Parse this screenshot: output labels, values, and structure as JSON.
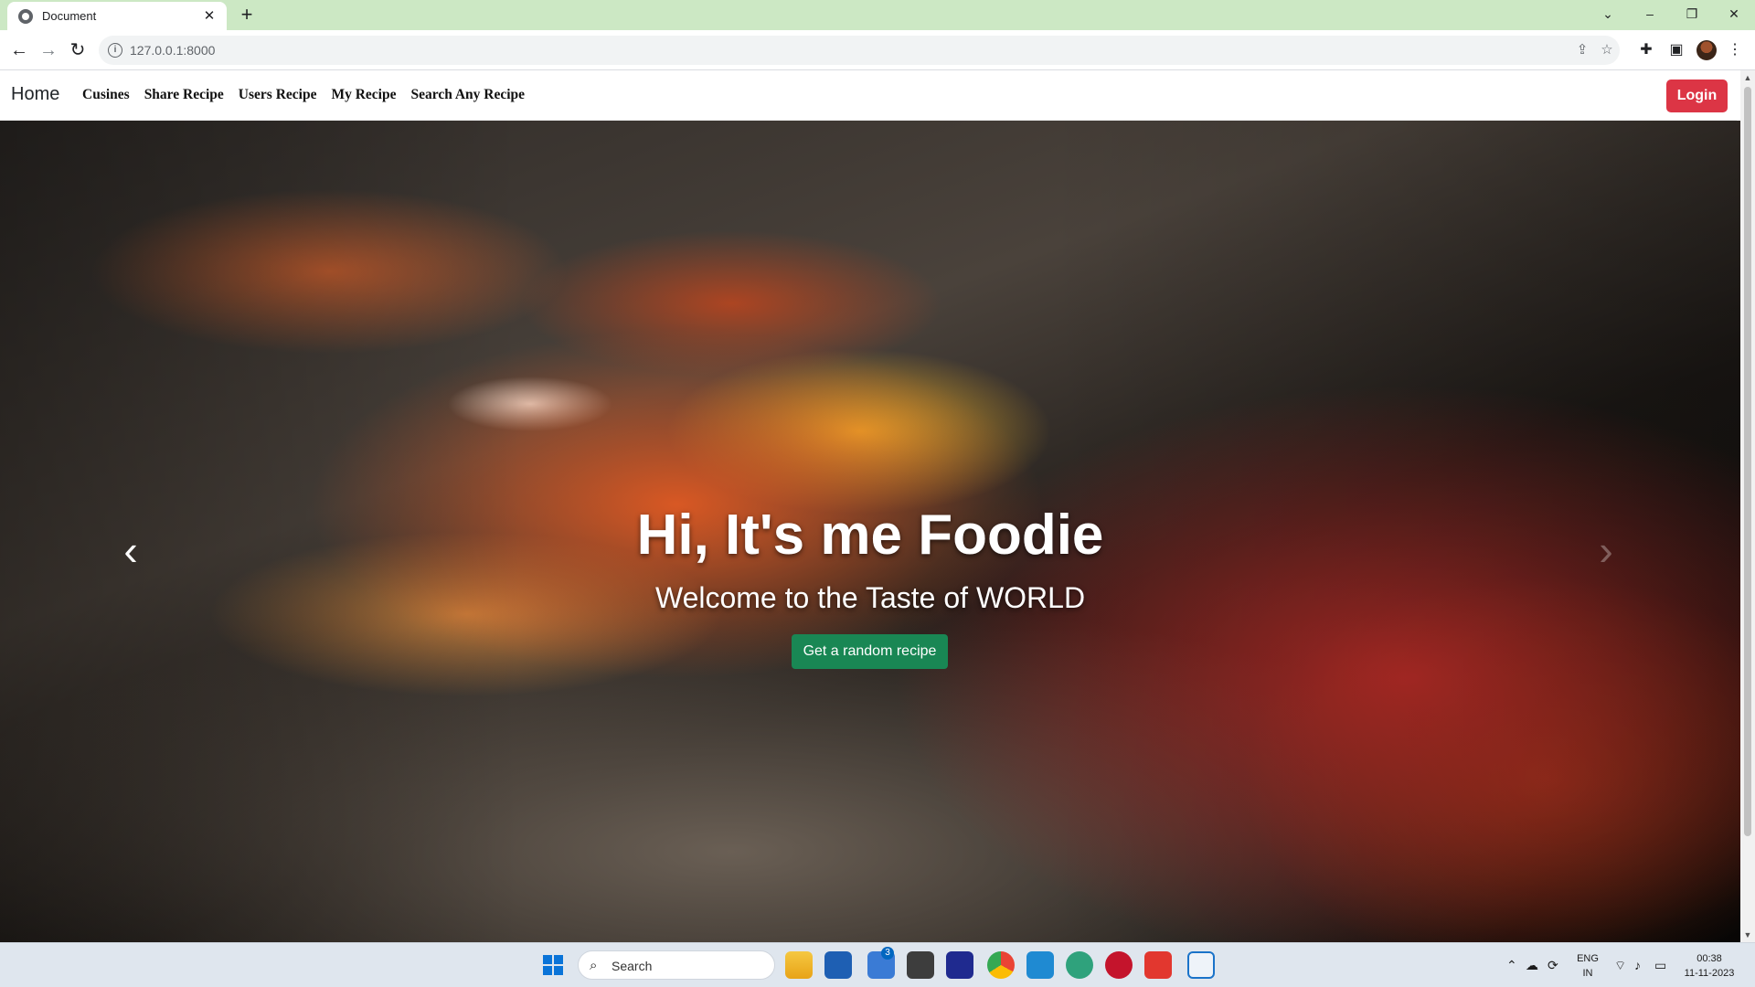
{
  "browser": {
    "tab_title": "Document",
    "tab_close": "✕",
    "new_tab": "+",
    "url": "127.0.0.1:8000",
    "window_controls": [
      "⌄",
      "–",
      "❐",
      "✕"
    ]
  },
  "navbar": {
    "brand": "Home",
    "links": [
      "Cusines",
      "Share Recipe",
      "Users Recipe",
      "My Recipe",
      "Search Any Recipe"
    ],
    "login_label": "Login"
  },
  "hero": {
    "title": "Hi, It's me Foodie",
    "subtitle": "Welcome to the Taste of WORLD",
    "button_label": "Get a random recipe",
    "prev_icon": "‹",
    "next_icon": "›"
  },
  "taskbar": {
    "search_placeholder": "Search",
    "badge_count": "3",
    "lang_top": "ENG",
    "lang_bottom": "IN",
    "time": "00:38",
    "date": "11-11-2023"
  },
  "colors": {
    "login": "#dc3545",
    "random_button": "#198754",
    "tab_strip": "#cce8c4"
  }
}
